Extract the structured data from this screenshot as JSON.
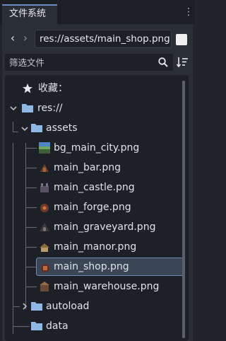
{
  "tabs": [
    {
      "label": "文件系统"
    }
  ],
  "path": {
    "value": "res://assets/main_shop.png"
  },
  "filter": {
    "placeholder": "筛选文件"
  },
  "tree": {
    "favorites_label": "收藏：",
    "root_label": "res://",
    "items": [
      {
        "label": "assets"
      },
      {
        "label": "bg_main_city.png"
      },
      {
        "label": "main_bar.png"
      },
      {
        "label": "main_castle.png"
      },
      {
        "label": "main_forge.png"
      },
      {
        "label": "main_graveyard.png"
      },
      {
        "label": "main_manor.png"
      },
      {
        "label": "main_shop.png"
      },
      {
        "label": "main_warehouse.png"
      },
      {
        "label": "autoload"
      },
      {
        "label": "data"
      }
    ]
  },
  "colors": {
    "accent": "#6a8ec4",
    "folder": "#8fb8e6",
    "selection": "#3a4656"
  }
}
